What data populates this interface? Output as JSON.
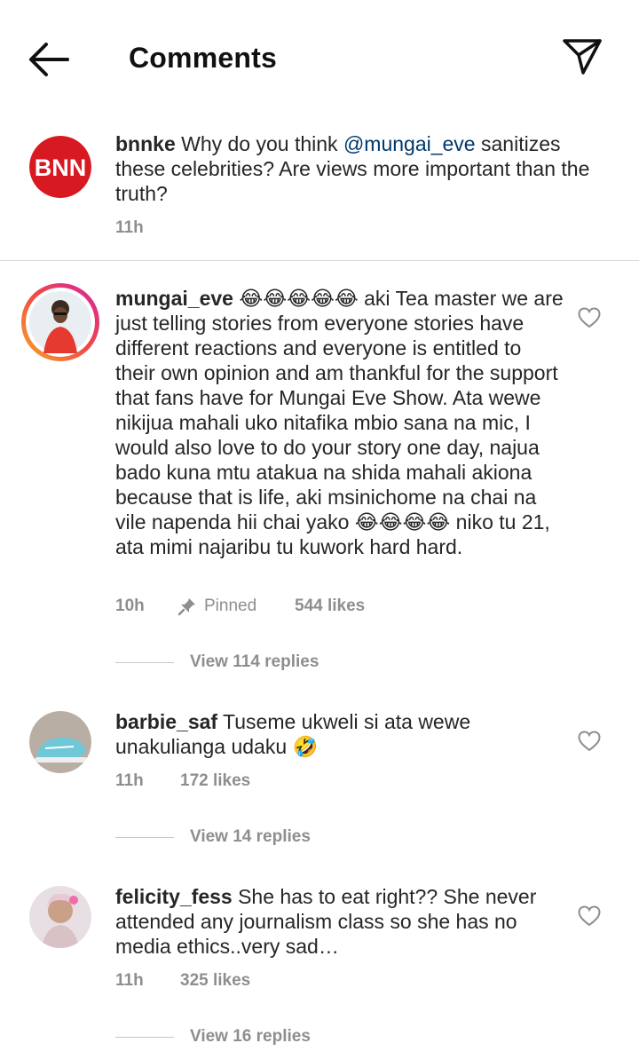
{
  "header": {
    "title": "Comments"
  },
  "caption": {
    "username": "bnnke",
    "avatar_text": "BNN",
    "text_before": " Why do you think ",
    "mention": "@mungai_eve",
    "text_after": " sanitizes these celebrities? Are views more important than the truth?",
    "time": "11h"
  },
  "comments": [
    {
      "username": "mungai_eve",
      "emoji_prefix": "😂😂😂😂😂",
      "text_part1": " aki Tea master we are just telling stories from everyone stories have different reactions and everyone is entitled to their own opinion and am thankful for the support that fans have for Mungai Eve Show. Ata wewe nikijua mahali uko nitafika mbio sana na mic, I would also love to do your story one day, najua bado kuna mtu atakua na shida mahali akiona because that is life, aki msinichome na chai na vile napenda hii chai yako ",
      "emoji_mid": "😂😂😂😂",
      "text_part2": " niko tu 21, ata mimi najaribu tu kuwork hard hard.",
      "time": "10h",
      "pinned_label": "Pinned",
      "likes": "544 likes",
      "replies": "View 114 replies"
    },
    {
      "username": "barbie_saf",
      "text": " Tuseme ukweli si ata wewe unakulianga udaku ",
      "emoji": "🤣",
      "time": "11h",
      "likes": "172 likes",
      "replies": "View 14 replies"
    },
    {
      "username": "felicity_fess",
      "text": " She has to eat right?? She never attended any journalism class so she has no media ethics..very sad…",
      "time": "11h",
      "likes": "325 likes",
      "replies": "View 16 replies"
    }
  ],
  "colors": {
    "brand_red": "#d71921",
    "story_ring_start": "#f9a825",
    "story_ring_end": "#d6249f",
    "meta_gray": "#8e8e8e",
    "mention_blue": "#00376b"
  },
  "icons": [
    "back-arrow-icon",
    "send-icon",
    "heart-icon",
    "pin-icon"
  ]
}
